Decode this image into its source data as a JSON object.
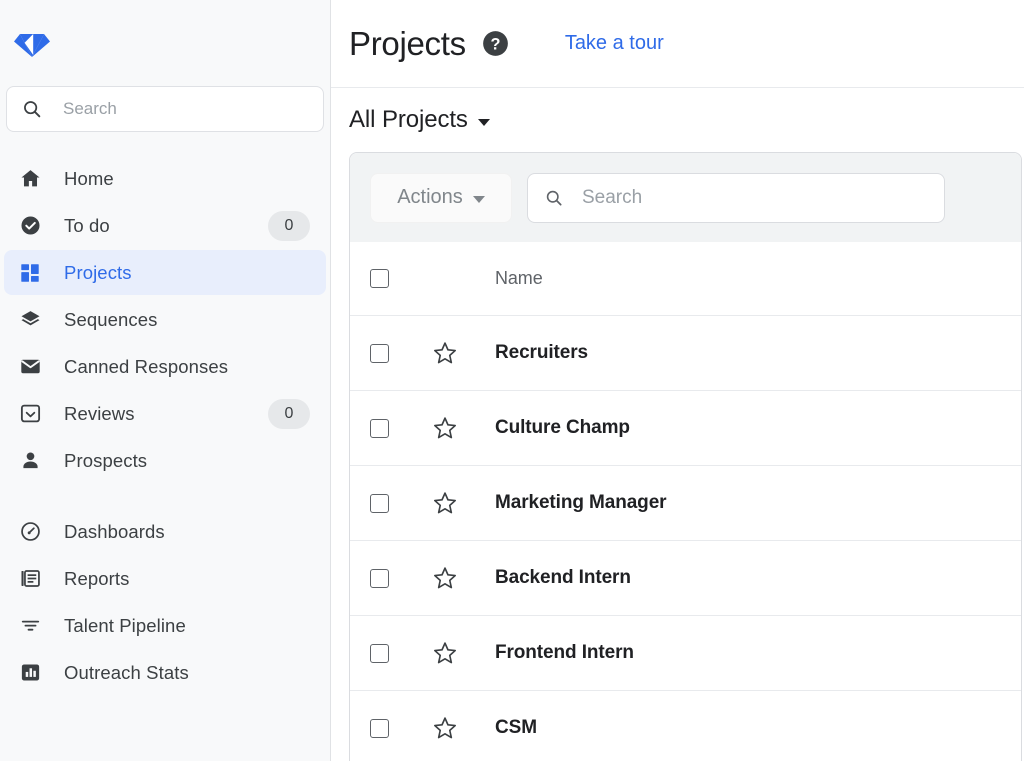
{
  "brand": {
    "logo_icon": "diamond-gem-logo",
    "accent_color": "#2f6be8",
    "logo_color": "#2f6be8"
  },
  "sidebar": {
    "search": {
      "icon": "search-icon",
      "placeholder": "Search",
      "value": ""
    },
    "groups": [
      {
        "items": [
          {
            "label": "Home",
            "icon": "home-icon",
            "badge": null,
            "active": false
          },
          {
            "label": "To do",
            "icon": "check-circle-icon",
            "badge": "0",
            "active": false
          },
          {
            "label": "Projects",
            "icon": "grid-squares-icon",
            "badge": null,
            "active": true
          },
          {
            "label": "Sequences",
            "icon": "layers-icon",
            "badge": null,
            "active": false
          },
          {
            "label": "Canned Responses",
            "icon": "envelope-icon",
            "badge": null,
            "active": false
          },
          {
            "label": "Reviews",
            "icon": "inbox-icon",
            "badge": "0",
            "active": false
          },
          {
            "label": "Prospects",
            "icon": "person-icon",
            "badge": null,
            "active": false
          }
        ]
      },
      {
        "items": [
          {
            "label": "Dashboards",
            "icon": "speedometer-icon",
            "badge": null,
            "active": false
          },
          {
            "label": "Reports",
            "icon": "document-icon",
            "badge": null,
            "active": false
          },
          {
            "label": "Talent Pipeline",
            "icon": "filter-icon",
            "badge": null,
            "active": false
          },
          {
            "label": "Outreach Stats",
            "icon": "bar-chart-icon",
            "badge": null,
            "active": false
          }
        ]
      }
    ]
  },
  "header": {
    "title": "Projects",
    "help_icon": "help-circle-icon",
    "tour_link": "Take a tour"
  },
  "filter": {
    "selected": "All Projects",
    "caret_icon": "chevron-down-icon"
  },
  "toolbar": {
    "actions_label": "Actions",
    "actions_caret_icon": "chevron-down-icon",
    "search": {
      "icon": "search-icon",
      "placeholder": "Search",
      "value": ""
    }
  },
  "table": {
    "columns": [
      "Name"
    ],
    "select_all_checked": false,
    "rows": [
      {
        "name": "Recruiters",
        "checked": false,
        "starred": false
      },
      {
        "name": "Culture Champ",
        "checked": false,
        "starred": false
      },
      {
        "name": "Marketing Manager",
        "checked": false,
        "starred": false
      },
      {
        "name": "Backend Intern",
        "checked": false,
        "starred": false
      },
      {
        "name": "Frontend Intern",
        "checked": false,
        "starred": false
      },
      {
        "name": "CSM",
        "checked": false,
        "starred": false
      }
    ]
  }
}
